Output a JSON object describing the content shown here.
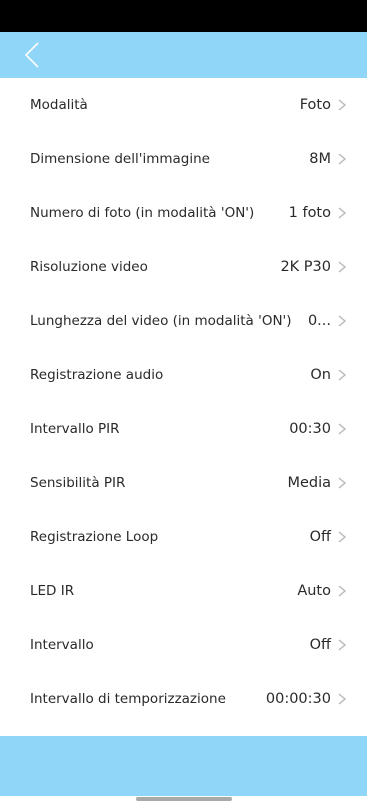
{
  "statusbar": {},
  "appbar": {
    "back_icon": "chevron-left-icon"
  },
  "settings": [
    {
      "name": "setting-row-modalita",
      "label": "Modalità",
      "value": "Foto"
    },
    {
      "name": "setting-row-dimensione-immagine",
      "label": "Dimensione dell'immagine",
      "value": "8M"
    },
    {
      "name": "setting-row-numero-foto",
      "label": "Numero di foto (in modalità 'ON')",
      "value": "1 foto"
    },
    {
      "name": "setting-row-risoluzione-video",
      "label": "Risoluzione video",
      "value": "2K P30"
    },
    {
      "name": "setting-row-lunghezza-video",
      "label": "Lunghezza del video (in modalità 'ON')",
      "value": "0..."
    },
    {
      "name": "setting-row-registrazione-audio",
      "label": "Registrazione audio",
      "value": "On"
    },
    {
      "name": "setting-row-intervallo-pir",
      "label": "Intervallo PIR",
      "value": "00:30"
    },
    {
      "name": "setting-row-sensibilita-pir",
      "label": "Sensibilità PIR",
      "value": "Media"
    },
    {
      "name": "setting-row-registrazione-loop",
      "label": "Registrazione Loop",
      "value": "Off"
    },
    {
      "name": "setting-row-led-ir",
      "label": "LED IR",
      "value": "Auto"
    },
    {
      "name": "setting-row-intervallo",
      "label": "Intervallo",
      "value": "Off"
    },
    {
      "name": "setting-row-intervallo-temporizzazione",
      "label": "Intervallo di temporizzazione",
      "value": "00:00:30"
    }
  ],
  "colors": {
    "accent": "#8fd6f8",
    "statusbar": "#000000",
    "chevron": "#b8b8b8"
  }
}
